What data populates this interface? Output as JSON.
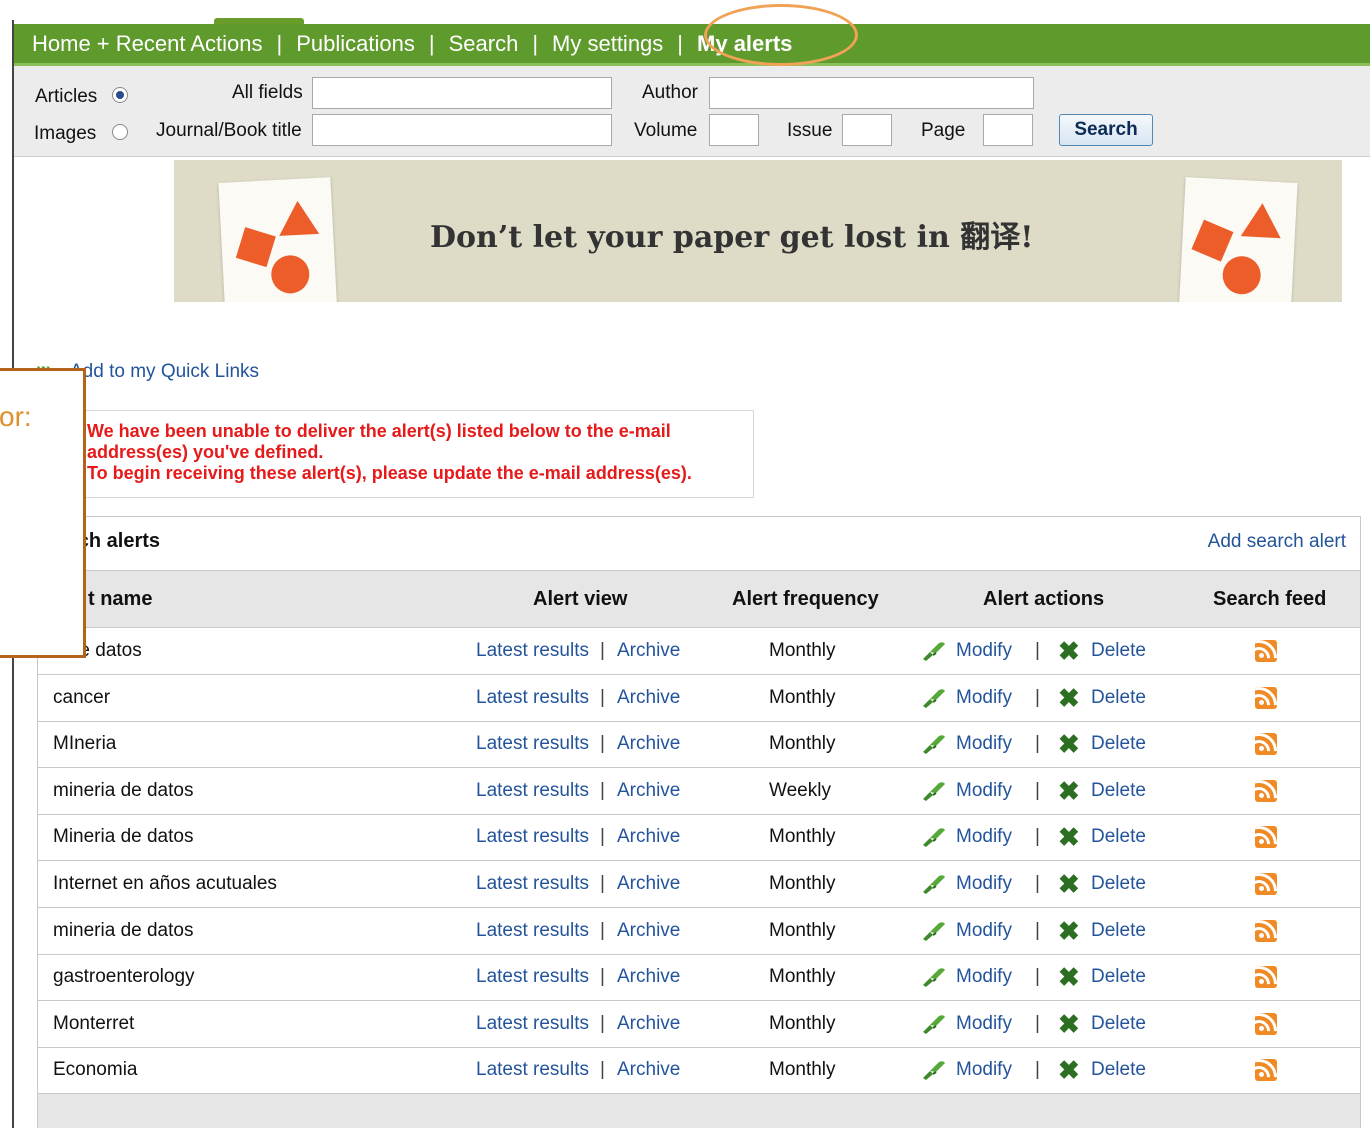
{
  "nav": {
    "items": [
      "Home + Recent Actions",
      "Publications",
      "Search",
      "My settings",
      "My alerts"
    ],
    "separator": "|"
  },
  "search_form": {
    "articles_label": "Articles",
    "images_label": "Images",
    "selected_type": "Articles",
    "all_fields_label": "All fields",
    "author_label": "Author",
    "journal_label": "Journal/Book title",
    "volume_label": "Volume",
    "issue_label": "Issue",
    "page_label": "Page",
    "search_button": "Search"
  },
  "banner": {
    "text": "Don’t let your paper get lost in 翻译!"
  },
  "quick_links": {
    "label": "Add to my Quick Links"
  },
  "warning": {
    "line1": "We have been unable to deliver the alert(s) listed below to the e-mail",
    "line2": "address(es) you've defined.",
    "line3": "To begin receiving these alert(s), please update the e-mail address(es)."
  },
  "callout": {
    "text": "or:"
  },
  "alerts_panel": {
    "title": "rch alerts",
    "add_link": "Add search alert",
    "columns": [
      "t name",
      "Alert view",
      "Alert frequency",
      "Alert actions",
      "Search feed"
    ],
    "latest_label": "Latest results",
    "archive_label": "Archive",
    "modify_label": "Modify",
    "delete_label": "Delete",
    "pipe": "|",
    "rows": [
      {
        "name": "e de datos",
        "frequency": "Monthly"
      },
      {
        "name": "cancer",
        "frequency": "Monthly"
      },
      {
        "name": "MIneria",
        "frequency": "Monthly"
      },
      {
        "name": "mineria de datos",
        "frequency": "Weekly"
      },
      {
        "name": "Mineria de datos",
        "frequency": "Monthly"
      },
      {
        "name": "Internet en años acutuales",
        "frequency": "Monthly"
      },
      {
        "name": "mineria de datos",
        "frequency": "Monthly"
      },
      {
        "name": "gastroenterology",
        "frequency": "Monthly"
      },
      {
        "name": "Monterret",
        "frequency": "Monthly"
      },
      {
        "name": "Economia",
        "frequency": "Monthly"
      }
    ]
  },
  "colors": {
    "nav_green": "#5f9a2d",
    "link_blue": "#23549b",
    "warning_red": "#e61a1a",
    "highlight_orange": "#f0a256",
    "rss_orange": "#f08a24"
  }
}
